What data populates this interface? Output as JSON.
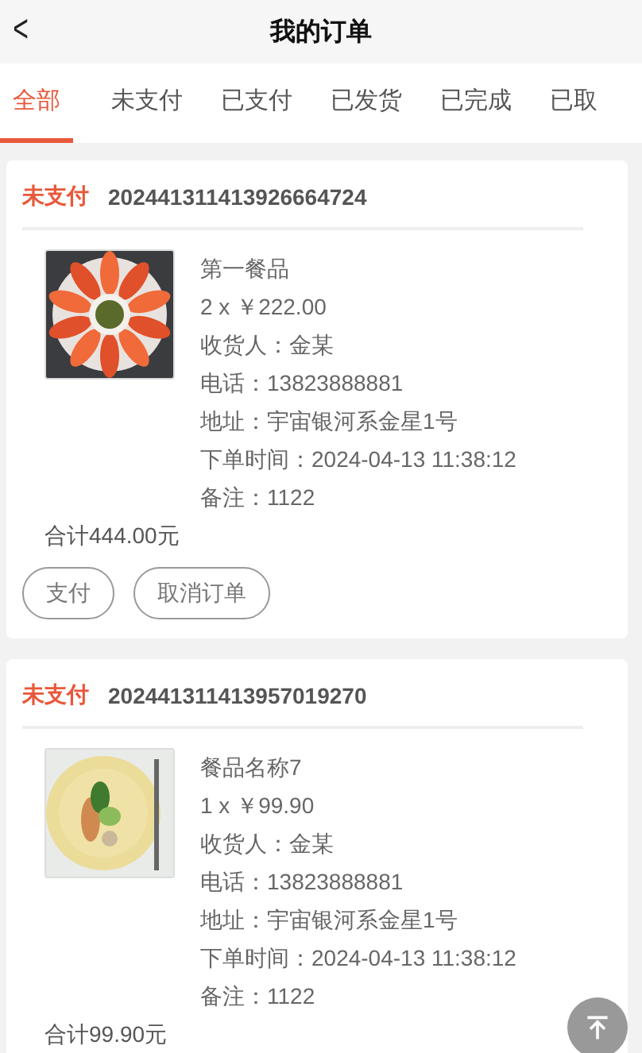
{
  "header": {
    "back": "<",
    "title": "我的订单"
  },
  "tabs": [
    {
      "label": "全部",
      "selected": true
    },
    {
      "label": "未支付",
      "selected": false
    },
    {
      "label": "已支付",
      "selected": false
    },
    {
      "label": "已发货",
      "selected": false
    },
    {
      "label": "已完成",
      "selected": false
    },
    {
      "label": "已取",
      "selected": false
    }
  ],
  "orders": [
    {
      "status": "未支付",
      "number": "202441311413926664724",
      "item": {
        "name": "第一餐品",
        "qty_price": "2 x ￥222.00"
      },
      "details": [
        "收货人：金某",
        "电话：13823888881",
        "地址：宇宙银河系金星1号",
        "下单时间：2024-04-13 11:38:12",
        "备注：1122"
      ],
      "total": "合计444.00元",
      "buttons": [
        "支付",
        "取消订单"
      ]
    },
    {
      "status": "未支付",
      "number": "202441311413957019270",
      "item": {
        "name": "餐品名称7",
        "qty_price": "1 x ￥99.90"
      },
      "details": [
        "收货人：金某",
        "电话：13823888881",
        "地址：宇宙银河系金星1号",
        "下单时间：2024-04-13 11:38:12",
        "备注：1122"
      ],
      "total": "合计99.90元"
    }
  ]
}
